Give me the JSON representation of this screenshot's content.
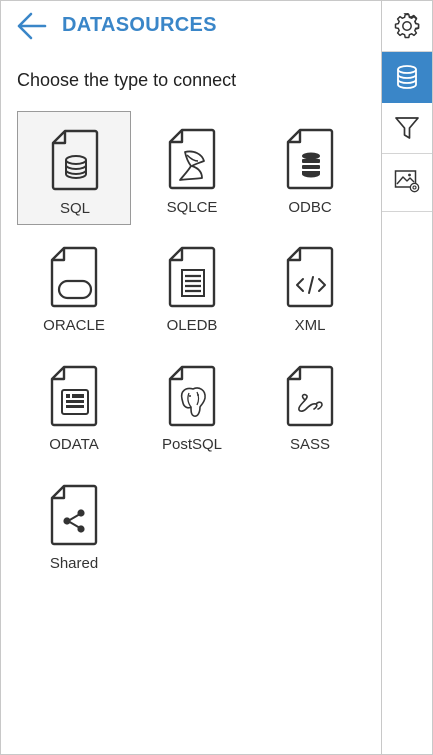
{
  "header": {
    "title": "DATASOURCES",
    "subtitle": "Choose the type to connect"
  },
  "accent": "#3a86c8",
  "datasources": [
    {
      "label": "SQL",
      "icon": "database-file-icon",
      "selected": true
    },
    {
      "label": "SQLCE",
      "icon": "sqlce-file-icon",
      "selected": false
    },
    {
      "label": "ODBC",
      "icon": "odbc-file-icon",
      "selected": false
    },
    {
      "label": "ORACLE",
      "icon": "oracle-file-icon",
      "selected": false
    },
    {
      "label": "OLEDB",
      "icon": "oledb-file-icon",
      "selected": false
    },
    {
      "label": "XML",
      "icon": "xml-file-icon",
      "selected": false
    },
    {
      "label": "ODATA",
      "icon": "odata-file-icon",
      "selected": false
    },
    {
      "label": "PostSQL",
      "icon": "postgresql-file-icon",
      "selected": false
    },
    {
      "label": "SASS",
      "icon": "sass-file-icon",
      "selected": false
    },
    {
      "label": "Shared",
      "icon": "share-file-icon",
      "selected": false
    }
  ],
  "sidebar": {
    "items": [
      {
        "name": "settings",
        "icon": "gear-icon",
        "active": false
      },
      {
        "name": "datasources",
        "icon": "database-icon",
        "active": true
      },
      {
        "name": "filter",
        "icon": "filter-icon",
        "active": false
      },
      {
        "name": "image-settings",
        "icon": "image-settings-icon",
        "active": false
      }
    ]
  }
}
